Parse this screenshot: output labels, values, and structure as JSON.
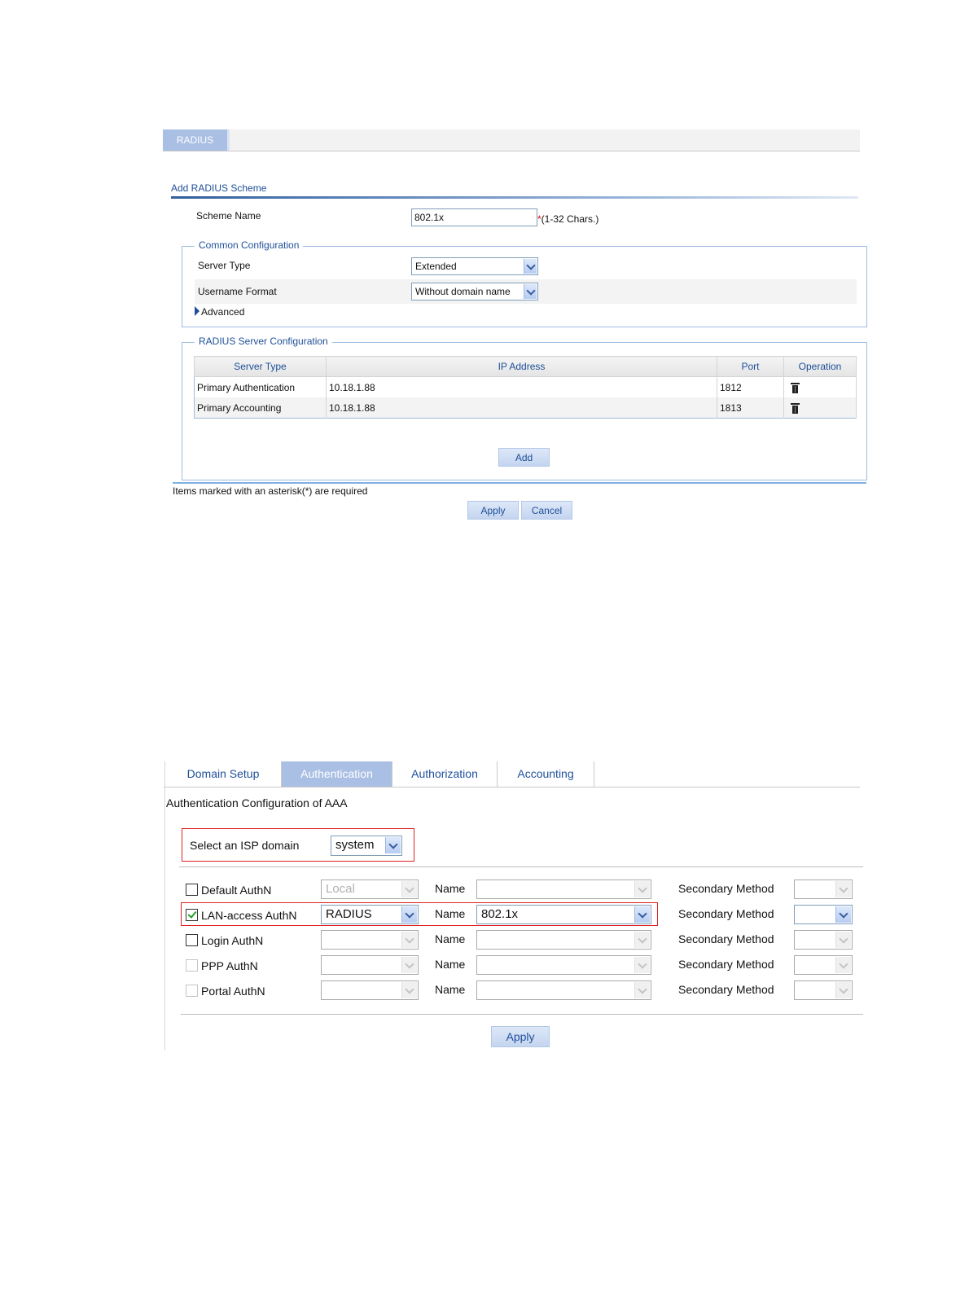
{
  "radius_screen": {
    "tab": "RADIUS",
    "heading": "Add RADIUS Scheme",
    "scheme_name": {
      "label": "Scheme Name",
      "value": "802.1x",
      "required_mark": "*",
      "hint": "(1-32 Chars.)"
    },
    "common": {
      "legend": "Common Configuration",
      "server_type": {
        "label": "Server Type",
        "value": "Extended"
      },
      "username_format": {
        "label": "Username Format",
        "value": "Without domain name"
      },
      "advanced": "Advanced"
    },
    "servers": {
      "legend": "RADIUS Server Configuration",
      "columns": [
        "Server Type",
        "IP Address",
        "Port",
        "Operation"
      ],
      "rows": [
        {
          "server_type": "Primary Authentication",
          "ip": "10.18.1.88",
          "port": "1812",
          "operation_icon": "trash-icon"
        },
        {
          "server_type": "Primary Accounting",
          "ip": "10.18.1.88",
          "port": "1813",
          "operation_icon": "trash-icon"
        }
      ],
      "add_button": "Add"
    },
    "required_note": "Items marked with an asterisk(*) are required",
    "apply_button": "Apply",
    "cancel_button": "Cancel"
  },
  "aaa_screen": {
    "tabs": [
      "Domain Setup",
      "Authentication",
      "Authorization",
      "Accounting"
    ],
    "active_tab": "Authentication",
    "title": "Authentication Configuration of AAA",
    "isp_domain": {
      "label": "Select an ISP domain",
      "value": "system"
    },
    "name_label": "Name",
    "secondary_label": "Secondary Method",
    "rows": [
      {
        "label": "Default AuthN",
        "checked": false,
        "method": "Local",
        "name": "",
        "secondary": ""
      },
      {
        "label": "LAN-access AuthN",
        "checked": true,
        "method": "RADIUS",
        "name": "802.1x",
        "secondary": ""
      },
      {
        "label": "Login AuthN",
        "checked": false,
        "method": "",
        "name": "",
        "secondary": ""
      },
      {
        "label": "PPP AuthN",
        "checked": false,
        "method": "",
        "name": "",
        "secondary": ""
      },
      {
        "label": "Portal AuthN",
        "checked": false,
        "method": "",
        "name": "",
        "secondary": ""
      }
    ],
    "apply_button": "Apply"
  },
  "colors": {
    "accent_blue": "#1f4f99",
    "tab_active": "#a9bfe3",
    "highlight_red": "#e02020",
    "check_green": "#21a121"
  }
}
